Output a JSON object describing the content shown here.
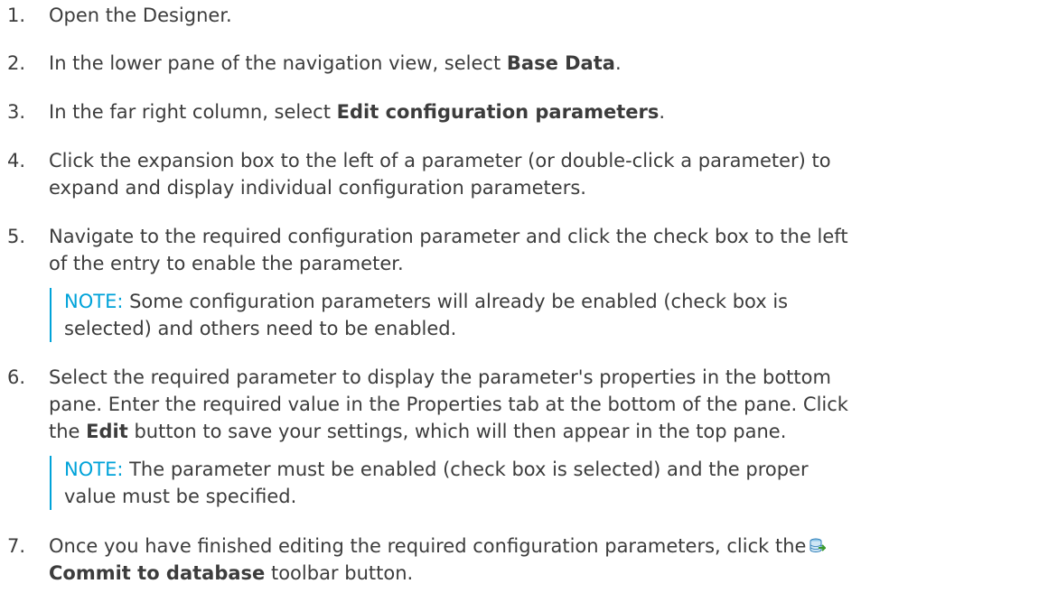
{
  "steps": [
    {
      "num": "1.",
      "text": "Open the Designer."
    },
    {
      "num": "2.",
      "pre": "In the lower pane of the navigation view, select ",
      "bold": "Base Data",
      "post": "."
    },
    {
      "num": "3.",
      "pre": "In the far right column, select ",
      "bold": "Edit configuration parameters",
      "post": "."
    },
    {
      "num": "4.",
      "line1": "Click the expansion box to the left of a parameter (or double-click a parameter) to",
      "line2": "expand and display individual configuration parameters."
    },
    {
      "num": "5.",
      "line1": "Navigate to the required configuration parameter and click the check box to the left",
      "line2": "of the entry to enable the parameter."
    },
    {
      "num": "6.",
      "line1": "Select the required parameter to display the parameter's properties in the bottom",
      "line2": "pane. Enter the required value in the Properties tab at the bottom of the pane. Click",
      "line3_pre": "the ",
      "line3_bold": "Edit",
      "line3_post": " button to save your settings, which will then appear in the top pane."
    },
    {
      "num": "7.",
      "line1": "Once you have finished editing the required configuration parameters, click the",
      "line2_bold": "Commit to database",
      "line2_post": " toolbar button."
    }
  ],
  "notes": [
    {
      "label": "NOTE:",
      "line1": " Some configuration parameters will already be enabled (check box is",
      "line2": "selected) and others need to be enabled."
    },
    {
      "label": "NOTE:",
      "line1": " The parameter must be enabled (check box is selected) and the proper",
      "line2": "value must be specified."
    }
  ],
  "icon": "commit-to-database-icon"
}
